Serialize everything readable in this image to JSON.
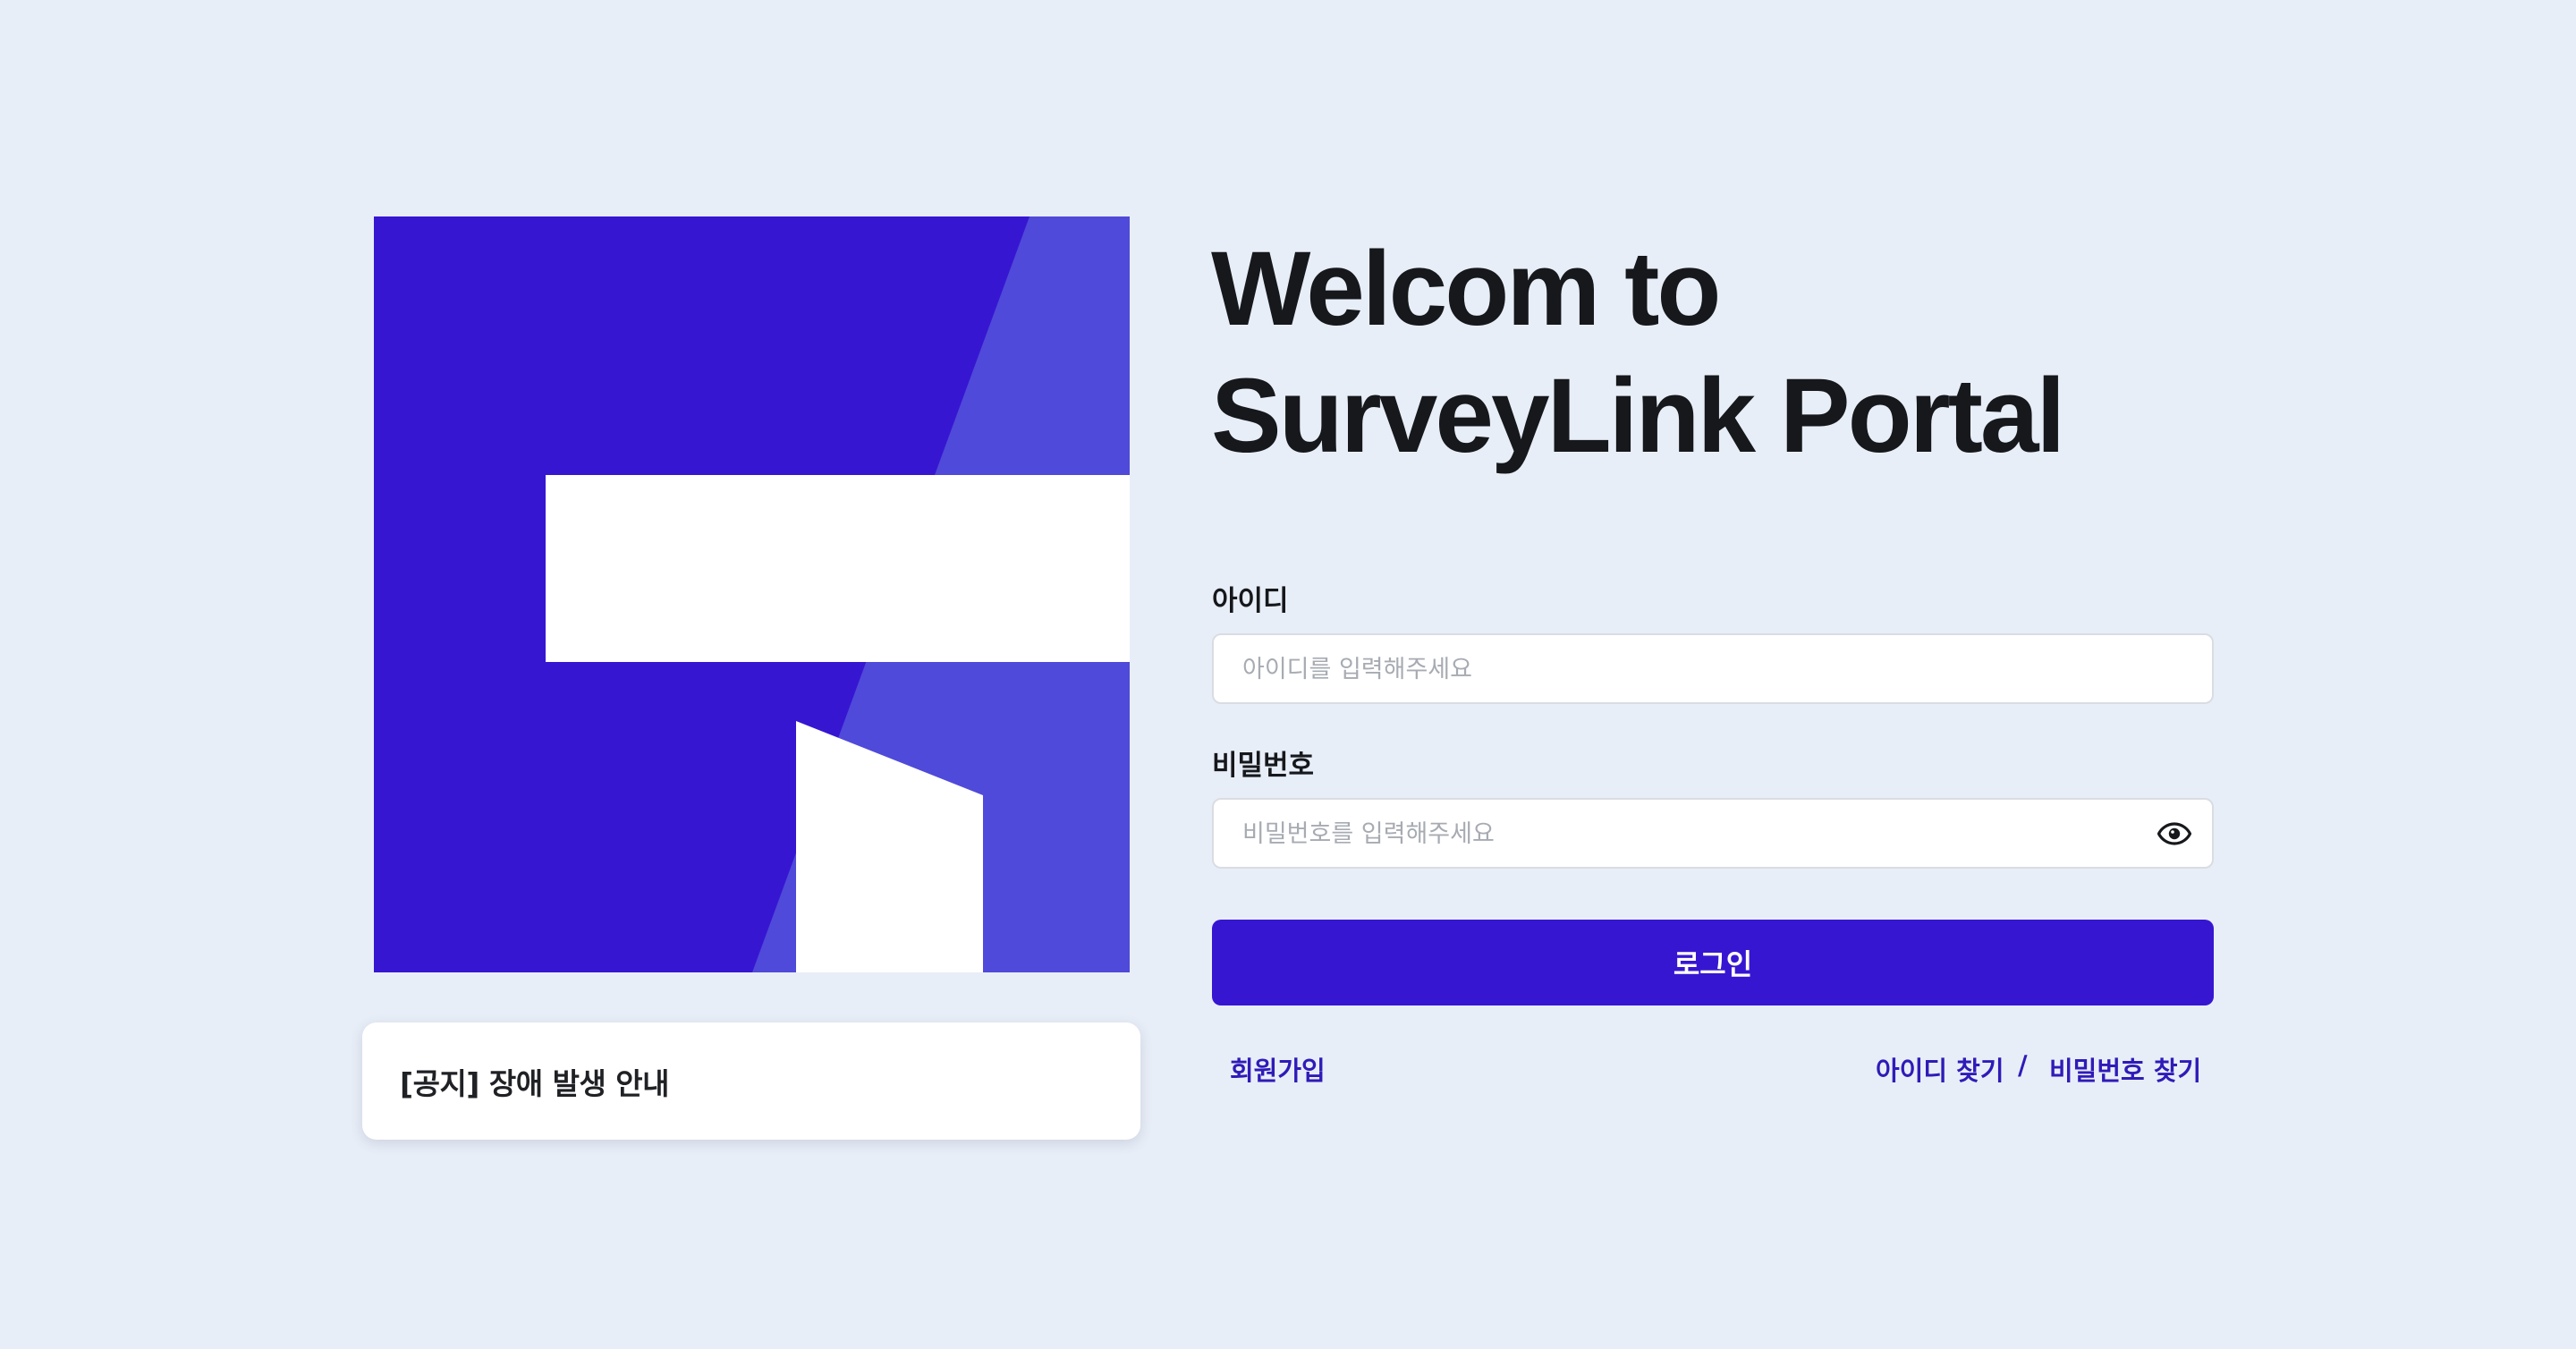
{
  "login": {
    "title_line1": "Welcom to",
    "title_line2": "SurveyLink Portal",
    "id_label": "아이디",
    "id_placeholder": "아이디를 입력해주세요",
    "id_value": "",
    "pw_label": "비밀번호",
    "pw_placeholder": "비밀번호를 입력해주세요",
    "pw_value": "",
    "password_toggle_icon": "eye-icon",
    "submit_label": "로그인",
    "signup_label": "회원가입",
    "find_id_label": "아이디 찾기",
    "separator": "/",
    "find_pw_label": "비밀번호 찾기"
  },
  "notice": {
    "text": "[공지] 장애 발생 안내"
  },
  "colors": {
    "background": "#e8eef7",
    "brand_primary": "#3716d2",
    "brand_secondary": "#4f4ad9",
    "link": "#2f1bb8",
    "text_dark": "#16181c"
  }
}
